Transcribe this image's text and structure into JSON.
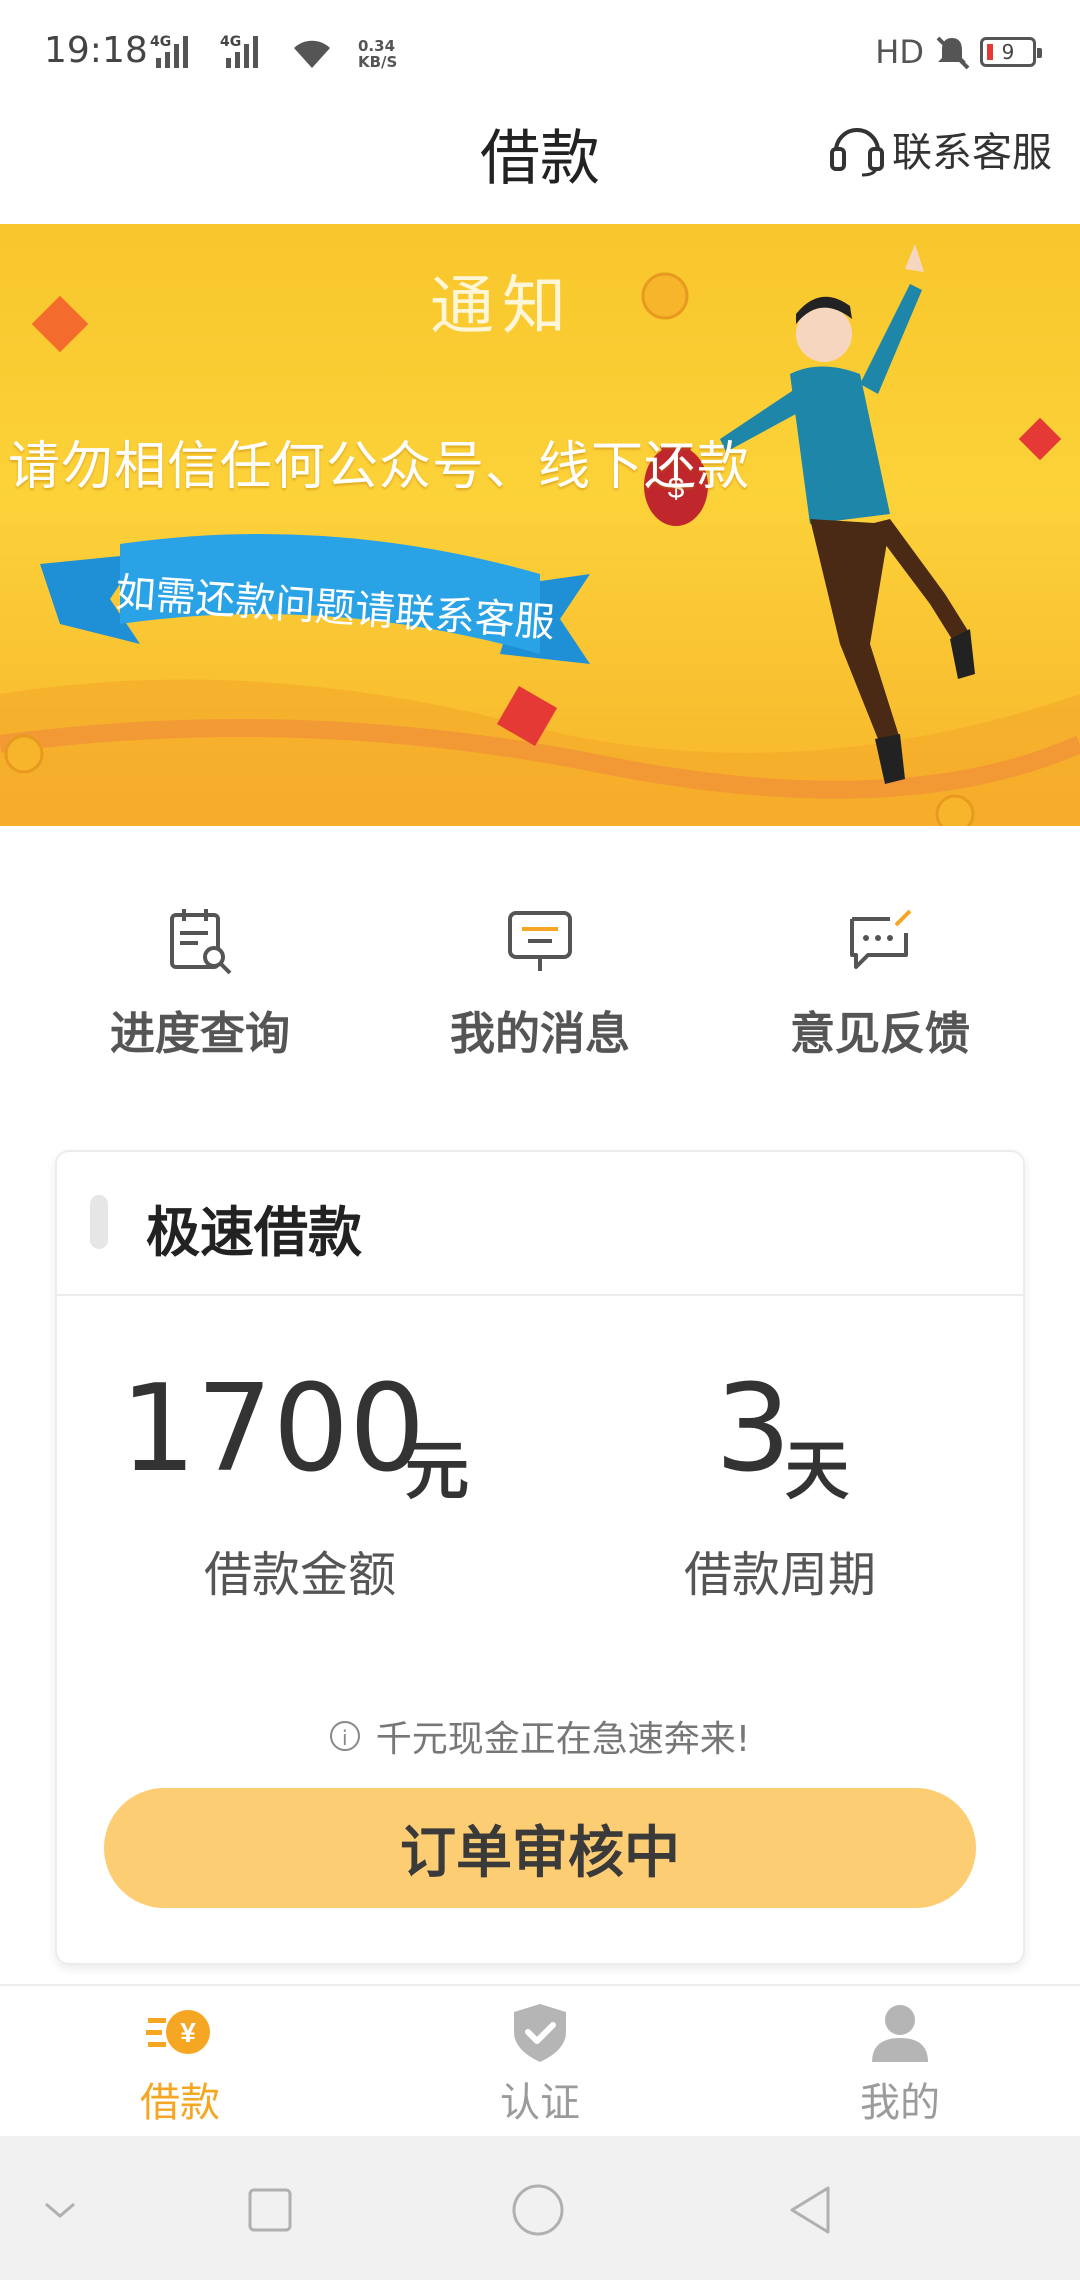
{
  "status_bar": {
    "time": "19:18",
    "signal1": "4G",
    "signal2": "4G",
    "speed_value": "0.34",
    "speed_unit": "KB/S",
    "hd": "HD",
    "battery": "9"
  },
  "header": {
    "title": "借款",
    "service_label": "联系客服"
  },
  "banner": {
    "notice": "通知",
    "warning": "请勿相信任何公众号、线下还款",
    "ribbon": "如需还款问题请联系客服"
  },
  "quick_actions": [
    {
      "label": "进度查询",
      "icon": "calendar-search-icon"
    },
    {
      "label": "我的消息",
      "icon": "message-icon"
    },
    {
      "label": "意见反馈",
      "icon": "feedback-icon"
    }
  ],
  "loan_card": {
    "title": "极速借款",
    "amount": "1700",
    "amount_unit": "元",
    "amount_label": "借款金额",
    "period": "3",
    "period_unit": "天",
    "period_label": "借款周期",
    "tip": "千元现金正在急速奔来!",
    "status_button": "订单审核中"
  },
  "tabs": [
    {
      "label": "借款",
      "icon": "loan-yen-icon",
      "active": true
    },
    {
      "label": "认证",
      "icon": "shield-check-icon",
      "active": false
    },
    {
      "label": "我的",
      "icon": "user-icon",
      "active": false
    }
  ],
  "colors": {
    "accent": "#f5a623",
    "button": "#fdcd74",
    "banner": "#fcd239",
    "tab_inactive": "#9b9b9b"
  }
}
